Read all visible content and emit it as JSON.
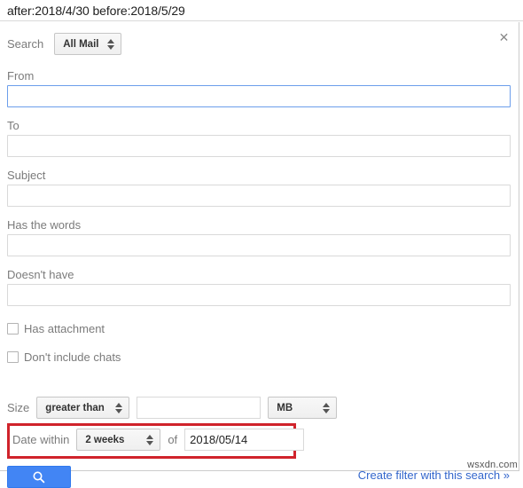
{
  "search_bar": {
    "query": "after:2018/4/30 before:2018/5/29"
  },
  "panel": {
    "close_icon": "✕",
    "scope": {
      "label": "Search",
      "selected": "All Mail"
    },
    "fields": [
      {
        "label": "From",
        "value": "",
        "focused": true
      },
      {
        "label": "To",
        "value": "",
        "focused": false
      },
      {
        "label": "Subject",
        "value": "",
        "focused": false
      },
      {
        "label": "Has the words",
        "value": "",
        "focused": false
      },
      {
        "label": "Doesn't have",
        "value": "",
        "focused": false
      }
    ],
    "checkboxes": [
      {
        "label": "Has attachment",
        "checked": false
      },
      {
        "label": "Don't include chats",
        "checked": false
      }
    ],
    "size_row": {
      "label": "Size",
      "operator": "greater than",
      "value": "",
      "unit": "MB"
    },
    "date_row": {
      "label": "Date within",
      "range": "2 weeks",
      "of_label": "of",
      "date": "2018/05/14",
      "highlight_color": "#d0232b"
    },
    "footer": {
      "search_button_icon": "search-icon",
      "create_filter_link": "Create filter with this search »"
    }
  },
  "watermark": "wsxdn.com",
  "colors": {
    "accent_blue": "#4285f4",
    "link_blue": "#3366cc",
    "focus_border": "#6c9eeb",
    "highlight_red": "#d0232b",
    "label_gray": "#7b7b7b"
  }
}
